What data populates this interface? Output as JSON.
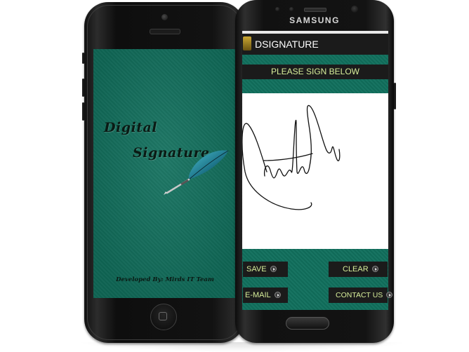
{
  "splash": {
    "title_line1": "Digital",
    "title_line2": "Signature",
    "credit": "Developed By: Mirds IT Team",
    "background_color": "#11705d"
  },
  "device_right": {
    "brand": "SAMSUNG"
  },
  "app": {
    "title": "DSIGNATURE",
    "prompt": "PLEASE SIGN BELOW",
    "accent_text_color": "#d7ee9a",
    "bar_color": "#1b1b1b",
    "buttons": {
      "save": "SAVE",
      "clear": "CLEAR",
      "email": "E-MAIL",
      "contact": "CONTACT US"
    },
    "button_icon": "arrow-right-circle-icon"
  }
}
